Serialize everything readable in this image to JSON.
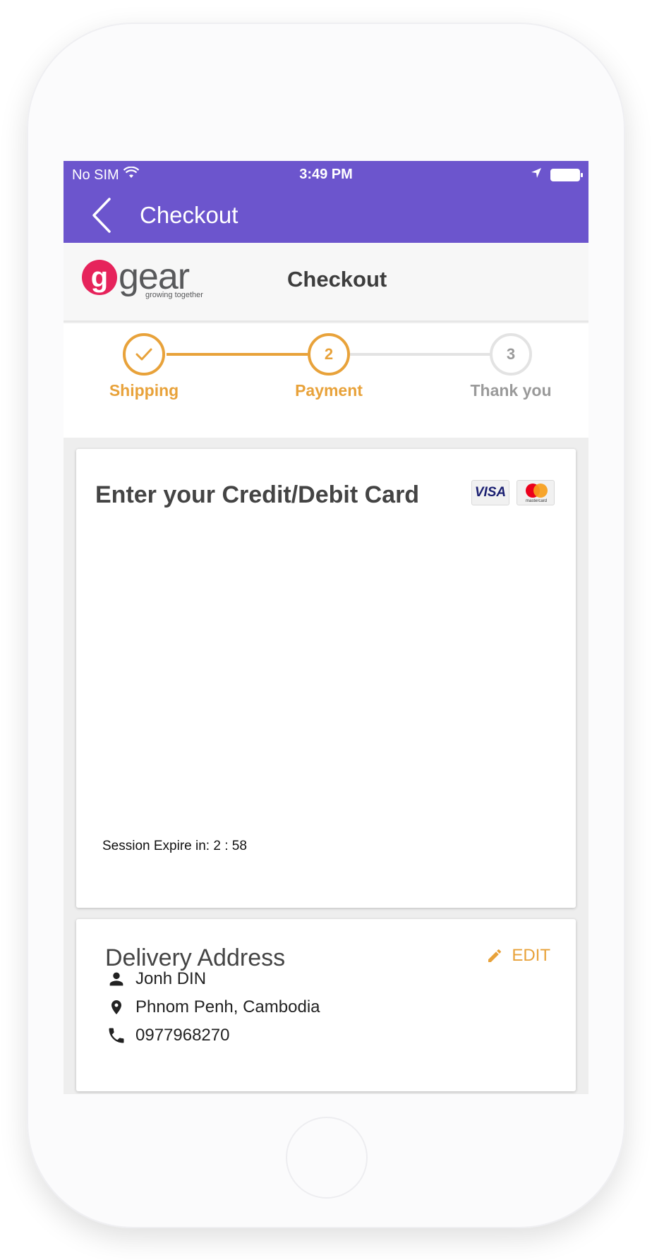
{
  "status_bar": {
    "carrier": "No SIM",
    "time": "3:49 PM"
  },
  "app_bar": {
    "title": "Checkout"
  },
  "header": {
    "logo_mark": "g",
    "logo_word": "gear",
    "logo_tagline": "growing together",
    "title": "Checkout"
  },
  "stepper": {
    "steps": [
      {
        "label": "Shipping",
        "marker": "",
        "state": "done"
      },
      {
        "label": "Payment",
        "marker": "2",
        "state": "current"
      },
      {
        "label": "Thank you",
        "marker": "3",
        "state": "upcoming"
      }
    ],
    "colors": {
      "active": "#e8a23a",
      "inactive": "#e3e3e3",
      "inactive_text": "#9a9a9a"
    }
  },
  "payment_card": {
    "heading": "Enter your Credit/Debit Card",
    "card_logos": [
      {
        "name": "visa-logo",
        "text": "VISA"
      },
      {
        "name": "mastercard-logo",
        "text": "mastercard"
      }
    ],
    "session_text": "Session Expire in: 2 : 58"
  },
  "delivery": {
    "heading": "Delivery Address",
    "edit_label": "EDIT",
    "name": "Jonh DIN",
    "location": "Phnom Penh, Cambodia",
    "phone": "0977968270"
  },
  "colors": {
    "primary": "#6c55cd",
    "accent": "#e8a23a",
    "brand": "#e6235b"
  }
}
